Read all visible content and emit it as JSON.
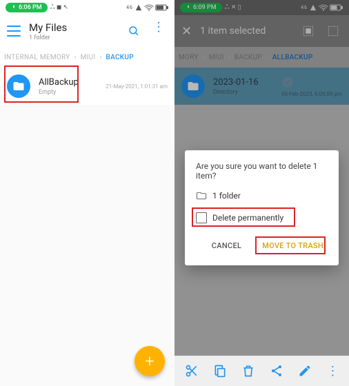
{
  "left": {
    "status_time": "6:06 PM",
    "status_ext": "ஃ ◼ ↖",
    "title": "My Files",
    "subtitle": "1 folder",
    "crumbs": [
      "INTERNAL MEMORY",
      "MIUI",
      "BACKUP"
    ],
    "item": {
      "name": "AllBackup",
      "sub": "Empty",
      "date": "21-May-2021, 1:01:31 am"
    }
  },
  "right": {
    "status_time": "6:09 PM",
    "status_ext": "ஃ ✕ ▯",
    "title": "1 item selected",
    "crumbs": [
      "MORY",
      "MIUI",
      "BACKUP",
      "ALLBACKUP"
    ],
    "item": {
      "name": "2023-01-16",
      "sub": "Directory",
      "date": "06-Feb-2023, 6:09:09 pm"
    },
    "dialog": {
      "msg": "Are you sure you want to delete 1 item?",
      "folder": "1 folder",
      "perm": "Delete permanently",
      "cancel": "CANCEL",
      "confirm": "MOVE TO TRASH"
    }
  }
}
